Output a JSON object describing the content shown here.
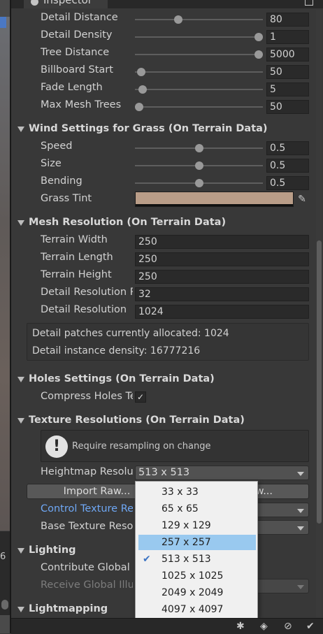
{
  "window": {
    "tab_title": "Inspector"
  },
  "scene": {
    "number": "6"
  },
  "tree_detail": [
    {
      "label": "Detail Distance",
      "value": "80",
      "slider": 0.33
    },
    {
      "label": "Detail Density",
      "value": "1",
      "slider": 1.0
    },
    {
      "label": "Tree Distance",
      "value": "5000",
      "slider": 1.0
    },
    {
      "label": "Billboard Start",
      "value": "50",
      "slider": 0.02
    },
    {
      "label": "Fade Length",
      "value": "5",
      "slider": 0.03
    },
    {
      "label": "Max Mesh Trees",
      "value": "50",
      "slider": 0.0
    }
  ],
  "wind": {
    "header": "Wind Settings for Grass (On Terrain Data)",
    "rows": [
      {
        "label": "Speed",
        "value": "0.5",
        "slider": 0.5
      },
      {
        "label": "Size",
        "value": "0.5",
        "slider": 0.5
      },
      {
        "label": "Bending",
        "value": "0.5",
        "slider": 0.5
      }
    ],
    "tint_label": "Grass Tint",
    "tint_color": "#b99d88"
  },
  "mesh": {
    "header": "Mesh Resolution (On Terrain Data)",
    "rows": [
      {
        "label": "Terrain Width",
        "value": "250"
      },
      {
        "label": "Terrain Length",
        "value": "250"
      },
      {
        "label": "Terrain Height",
        "value": "250"
      },
      {
        "label": "Detail Resolution Per Patch",
        "value": "32"
      },
      {
        "label": "Detail Resolution",
        "value": "1024"
      }
    ],
    "info": [
      "Detail patches currently allocated: 1024",
      "Detail instance density: 16777216"
    ]
  },
  "holes": {
    "header": "Holes Settings (On Terrain Data)",
    "compress_label": "Compress Holes Texture",
    "compress_checked": true
  },
  "texres": {
    "header": "Texture Resolutions (On Terrain Data)",
    "warning": "Require resampling on change",
    "heightmap_label": "Heightmap Resolution",
    "heightmap_value": "513 x 513",
    "import_raw": "Import Raw...",
    "export_raw": "Export Raw...",
    "control_label": "Control Texture Resolution",
    "base_label": "Base Texture Resolution"
  },
  "heightmap_options": [
    {
      "label": "33 x 33",
      "highlighted": false,
      "checked": false
    },
    {
      "label": "65 x 65",
      "highlighted": false,
      "checked": false
    },
    {
      "label": "129 x 129",
      "highlighted": false,
      "checked": false
    },
    {
      "label": "257 x 257",
      "highlighted": true,
      "checked": false
    },
    {
      "label": "513 x 513",
      "highlighted": false,
      "checked": true
    },
    {
      "label": "1025 x 1025",
      "highlighted": false,
      "checked": false
    },
    {
      "label": "2049 x 2049",
      "highlighted": false,
      "checked": false
    },
    {
      "label": "4097 x 4097",
      "highlighted": false,
      "checked": false
    }
  ],
  "lighting": {
    "header": "Lighting",
    "contribute_label": "Contribute Global Illumination",
    "receive_label": "Receive Global Illumination"
  },
  "lightmapping": {
    "header": "Lightmapping"
  },
  "colors": {
    "accent_highlight": "#99c9ef",
    "link_label": "#6fa8f5"
  }
}
